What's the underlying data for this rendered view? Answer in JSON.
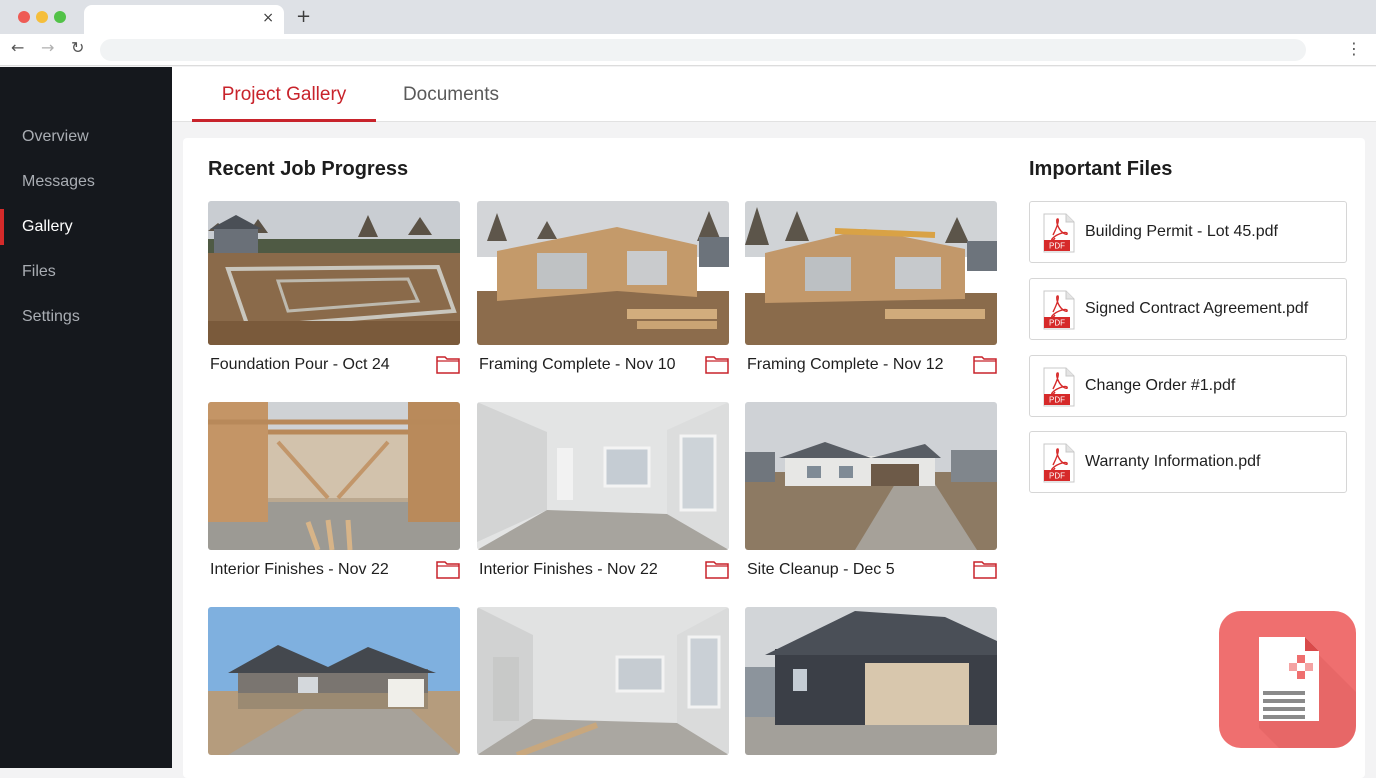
{
  "browser": {
    "close_glyph": "×",
    "new_tab_glyph": "+",
    "back_glyph": "←",
    "forward_glyph": "→",
    "reload_glyph": "↻",
    "menu_glyph": "⋮"
  },
  "sidebar": {
    "items": [
      {
        "label": "Overview"
      },
      {
        "label": "Messages"
      },
      {
        "label": "Gallery"
      },
      {
        "label": "Files"
      },
      {
        "label": "Settings"
      }
    ],
    "active": "Gallery"
  },
  "tabs": [
    {
      "label": "Project Gallery"
    },
    {
      "label": "Documents"
    }
  ],
  "gallery": {
    "title": "Recent Job Progress",
    "items": [
      {
        "caption": "Foundation Pour - Oct 24"
      },
      {
        "caption": "Framing Complete - Nov 10"
      },
      {
        "caption": "Framing Complete - Nov 12"
      },
      {
        "caption": "Interior Finishes - Nov 22"
      },
      {
        "caption": "Interior Finishes - Nov 22"
      },
      {
        "caption": "Site Cleanup - Dec 5"
      },
      {
        "caption": ""
      },
      {
        "caption": ""
      },
      {
        "caption": ""
      }
    ]
  },
  "files": {
    "title": "Important Files",
    "badge": "PDF",
    "items": [
      {
        "name": "Building Permit - Lot 45.pdf"
      },
      {
        "name": "Signed Contract Agreement.pdf"
      },
      {
        "name": "Change Order #1.pdf"
      },
      {
        "name": "Warranty Information.pdf"
      }
    ]
  },
  "colors": {
    "accent": "#c8232b",
    "sidebar_bg": "#15181d",
    "fab_bg": "#ef6f6f"
  },
  "icons": {
    "folder": "folder-icon",
    "pdf": "pdf-file-icon",
    "fab": "document-icon"
  }
}
